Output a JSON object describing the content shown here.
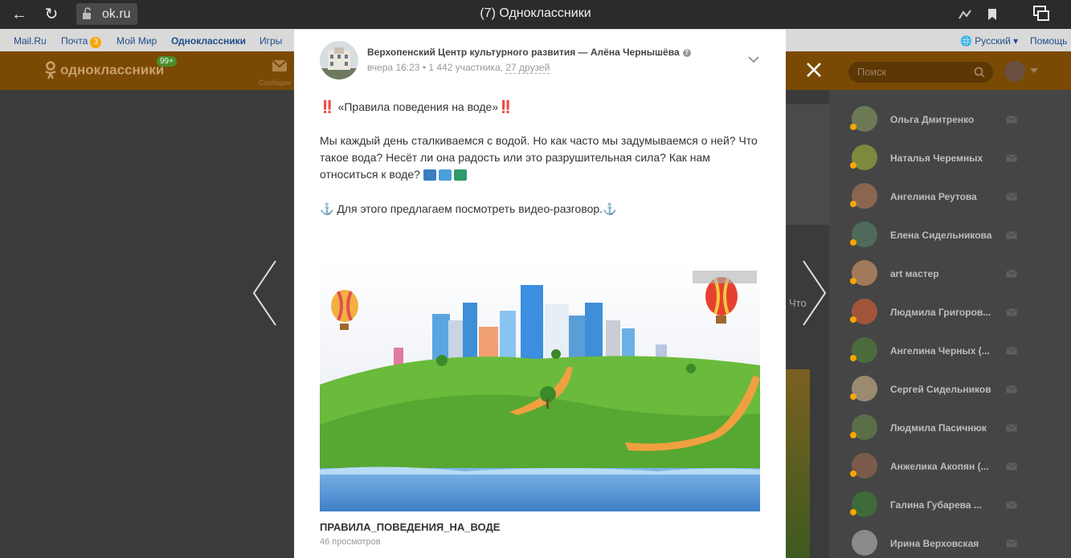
{
  "browser": {
    "url": "ok.ru",
    "tab_title": "(7) Одноклассники"
  },
  "mailru_bar": {
    "links": [
      "Mail.Ru",
      "Почта",
      "Мой Мир",
      "Одноклассники",
      "Игры"
    ],
    "mail_count": "3",
    "language": "Русский",
    "help": "Помощь"
  },
  "header": {
    "logo_text": "одноклассники",
    "notifications_badge": "99+",
    "messages_label": "Сообщения",
    "search_placeholder": "Поиск"
  },
  "post": {
    "group_name": "Верхопенский Центр культурного развития — Алёна Чернышёва",
    "time": "вчера 16:23",
    "participants": "1 442 участника",
    "friends": "27 друзей",
    "emoji_exclaim": "‼️",
    "headline": "«Правила поведения на воде»",
    "paragraph1": "Мы каждый день сталкиваемся с водой. Но как часто мы задумываемся о ней? Что такое вода? Несёт ли она радость или это разрушительная сила? Как нам относиться к воде?",
    "anchor": "⚓",
    "paragraph2": "Для этого предлагаем посмотреть видео-разговор.",
    "video_title": "ПРАВИЛА_ПОВЕДЕНИЯ_НА_ВОДЕ",
    "video_views": "46 просмотров"
  },
  "background": {
    "partial_text": "Что"
  },
  "friends_list": [
    {
      "name": "Ольга Дмитренко",
      "avatar_color": "#6b7a55"
    },
    {
      "name": "Наталья Черемных",
      "avatar_color": "#7d8a3d"
    },
    {
      "name": "Ангелина Реутова",
      "avatar_color": "#8a6650"
    },
    {
      "name": "Елена Сидельникова",
      "avatar_color": "#4f6a5a"
    },
    {
      "name": "art мастер",
      "avatar_color": "#a07a5a"
    },
    {
      "name": "Людмила Григоров...",
      "avatar_color": "#a0553a"
    },
    {
      "name": "Ангелина Черных (...",
      "avatar_color": "#4c6b3d"
    },
    {
      "name": "Сергей Сидельников",
      "avatar_color": "#9a8a70"
    },
    {
      "name": "Людмила Пасичнюк",
      "avatar_color": "#5a6e48"
    },
    {
      "name": "Анжелика Акопян (...",
      "avatar_color": "#7a5a4a"
    },
    {
      "name": "Галина Губарева ...",
      "avatar_color": "#3f6a3a"
    },
    {
      "name": "Ирина Верховская",
      "avatar_color": "#8a8a88"
    }
  ]
}
